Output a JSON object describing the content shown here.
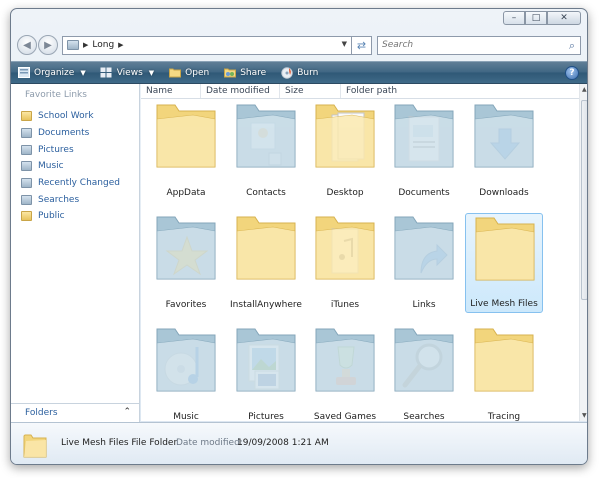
{
  "window": {
    "caption_buttons": {
      "minimize": "–",
      "maximize": "□",
      "close": "✕"
    }
  },
  "address": {
    "breadcrumb": [
      "Long"
    ],
    "search_placeholder": "Search"
  },
  "toolbar": {
    "organize": "Organize",
    "views": "Views",
    "open": "Open",
    "share": "Share",
    "burn": "Burn",
    "help": "?"
  },
  "nav": {
    "heading": "Favorite Links",
    "items": [
      {
        "label": "School Work",
        "icon": "folder-icon"
      },
      {
        "label": "Documents",
        "icon": "documents-icon"
      },
      {
        "label": "Pictures",
        "icon": "pictures-icon"
      },
      {
        "label": "Music",
        "icon": "music-icon"
      },
      {
        "label": "Recently Changed",
        "icon": "recently-changed-icon"
      },
      {
        "label": "Searches",
        "icon": "searches-icon"
      },
      {
        "label": "Public",
        "icon": "folder-icon"
      }
    ],
    "folders_label": "Folders"
  },
  "columns": [
    "Name",
    "Date modified",
    "Size",
    "Folder path"
  ],
  "items": [
    {
      "label": "AppData",
      "icon": "plain-folder-icon"
    },
    {
      "label": "Contacts",
      "icon": "contacts-folder-icon"
    },
    {
      "label": "Desktop",
      "icon": "desktop-folder-icon"
    },
    {
      "label": "Documents",
      "icon": "documents-folder-icon"
    },
    {
      "label": "Downloads",
      "icon": "downloads-folder-icon"
    },
    {
      "label": "Favorites",
      "icon": "favorites-folder-icon"
    },
    {
      "label": "InstallAnywhere",
      "icon": "plain-folder-icon"
    },
    {
      "label": "iTunes",
      "icon": "itunes-folder-icon"
    },
    {
      "label": "Links",
      "icon": "links-folder-icon"
    },
    {
      "label": "Live Mesh Files",
      "icon": "plain-folder-icon",
      "selected": true
    },
    {
      "label": "Music",
      "icon": "music-folder-icon"
    },
    {
      "label": "Pictures",
      "icon": "pictures-folder-icon"
    },
    {
      "label": "Saved Games",
      "icon": "saved-games-folder-icon"
    },
    {
      "label": "Searches",
      "icon": "searches-folder-icon"
    },
    {
      "label": "Tracing",
      "icon": "plain-folder-icon"
    }
  ],
  "details": {
    "name": "Live Mesh Files File Folder",
    "date_label": "Date modified:",
    "date_value": "19/09/2008 1:21 AM"
  },
  "colors": {
    "toolbar": "#3f6683",
    "link": "#2b5f9e",
    "selection": "#cce8fb",
    "folder_yellow": "#f2d57c",
    "folder_blue": "#a9c6d6"
  }
}
